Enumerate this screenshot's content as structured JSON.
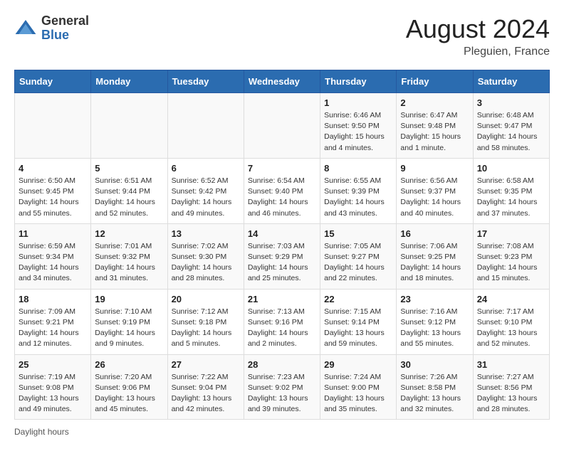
{
  "header": {
    "logo_general": "General",
    "logo_blue": "Blue",
    "month_year": "August 2024",
    "location": "Pleguien, France"
  },
  "days_of_week": [
    "Sunday",
    "Monday",
    "Tuesday",
    "Wednesday",
    "Thursday",
    "Friday",
    "Saturday"
  ],
  "footer": {
    "daylight_label": "Daylight hours"
  },
  "weeks": [
    {
      "days": [
        {
          "num": "",
          "info": ""
        },
        {
          "num": "",
          "info": ""
        },
        {
          "num": "",
          "info": ""
        },
        {
          "num": "",
          "info": ""
        },
        {
          "num": "1",
          "info": "Sunrise: 6:46 AM\nSunset: 9:50 PM\nDaylight: 15 hours\nand 4 minutes."
        },
        {
          "num": "2",
          "info": "Sunrise: 6:47 AM\nSunset: 9:48 PM\nDaylight: 15 hours\nand 1 minute."
        },
        {
          "num": "3",
          "info": "Sunrise: 6:48 AM\nSunset: 9:47 PM\nDaylight: 14 hours\nand 58 minutes."
        }
      ]
    },
    {
      "days": [
        {
          "num": "4",
          "info": "Sunrise: 6:50 AM\nSunset: 9:45 PM\nDaylight: 14 hours\nand 55 minutes."
        },
        {
          "num": "5",
          "info": "Sunrise: 6:51 AM\nSunset: 9:44 PM\nDaylight: 14 hours\nand 52 minutes."
        },
        {
          "num": "6",
          "info": "Sunrise: 6:52 AM\nSunset: 9:42 PM\nDaylight: 14 hours\nand 49 minutes."
        },
        {
          "num": "7",
          "info": "Sunrise: 6:54 AM\nSunset: 9:40 PM\nDaylight: 14 hours\nand 46 minutes."
        },
        {
          "num": "8",
          "info": "Sunrise: 6:55 AM\nSunset: 9:39 PM\nDaylight: 14 hours\nand 43 minutes."
        },
        {
          "num": "9",
          "info": "Sunrise: 6:56 AM\nSunset: 9:37 PM\nDaylight: 14 hours\nand 40 minutes."
        },
        {
          "num": "10",
          "info": "Sunrise: 6:58 AM\nSunset: 9:35 PM\nDaylight: 14 hours\nand 37 minutes."
        }
      ]
    },
    {
      "days": [
        {
          "num": "11",
          "info": "Sunrise: 6:59 AM\nSunset: 9:34 PM\nDaylight: 14 hours\nand 34 minutes."
        },
        {
          "num": "12",
          "info": "Sunrise: 7:01 AM\nSunset: 9:32 PM\nDaylight: 14 hours\nand 31 minutes."
        },
        {
          "num": "13",
          "info": "Sunrise: 7:02 AM\nSunset: 9:30 PM\nDaylight: 14 hours\nand 28 minutes."
        },
        {
          "num": "14",
          "info": "Sunrise: 7:03 AM\nSunset: 9:29 PM\nDaylight: 14 hours\nand 25 minutes."
        },
        {
          "num": "15",
          "info": "Sunrise: 7:05 AM\nSunset: 9:27 PM\nDaylight: 14 hours\nand 22 minutes."
        },
        {
          "num": "16",
          "info": "Sunrise: 7:06 AM\nSunset: 9:25 PM\nDaylight: 14 hours\nand 18 minutes."
        },
        {
          "num": "17",
          "info": "Sunrise: 7:08 AM\nSunset: 9:23 PM\nDaylight: 14 hours\nand 15 minutes."
        }
      ]
    },
    {
      "days": [
        {
          "num": "18",
          "info": "Sunrise: 7:09 AM\nSunset: 9:21 PM\nDaylight: 14 hours\nand 12 minutes."
        },
        {
          "num": "19",
          "info": "Sunrise: 7:10 AM\nSunset: 9:19 PM\nDaylight: 14 hours\nand 9 minutes."
        },
        {
          "num": "20",
          "info": "Sunrise: 7:12 AM\nSunset: 9:18 PM\nDaylight: 14 hours\nand 5 minutes."
        },
        {
          "num": "21",
          "info": "Sunrise: 7:13 AM\nSunset: 9:16 PM\nDaylight: 14 hours\nand 2 minutes."
        },
        {
          "num": "22",
          "info": "Sunrise: 7:15 AM\nSunset: 9:14 PM\nDaylight: 13 hours\nand 59 minutes."
        },
        {
          "num": "23",
          "info": "Sunrise: 7:16 AM\nSunset: 9:12 PM\nDaylight: 13 hours\nand 55 minutes."
        },
        {
          "num": "24",
          "info": "Sunrise: 7:17 AM\nSunset: 9:10 PM\nDaylight: 13 hours\nand 52 minutes."
        }
      ]
    },
    {
      "days": [
        {
          "num": "25",
          "info": "Sunrise: 7:19 AM\nSunset: 9:08 PM\nDaylight: 13 hours\nand 49 minutes."
        },
        {
          "num": "26",
          "info": "Sunrise: 7:20 AM\nSunset: 9:06 PM\nDaylight: 13 hours\nand 45 minutes."
        },
        {
          "num": "27",
          "info": "Sunrise: 7:22 AM\nSunset: 9:04 PM\nDaylight: 13 hours\nand 42 minutes."
        },
        {
          "num": "28",
          "info": "Sunrise: 7:23 AM\nSunset: 9:02 PM\nDaylight: 13 hours\nand 39 minutes."
        },
        {
          "num": "29",
          "info": "Sunrise: 7:24 AM\nSunset: 9:00 PM\nDaylight: 13 hours\nand 35 minutes."
        },
        {
          "num": "30",
          "info": "Sunrise: 7:26 AM\nSunset: 8:58 PM\nDaylight: 13 hours\nand 32 minutes."
        },
        {
          "num": "31",
          "info": "Sunrise: 7:27 AM\nSunset: 8:56 PM\nDaylight: 13 hours\nand 28 minutes."
        }
      ]
    }
  ]
}
